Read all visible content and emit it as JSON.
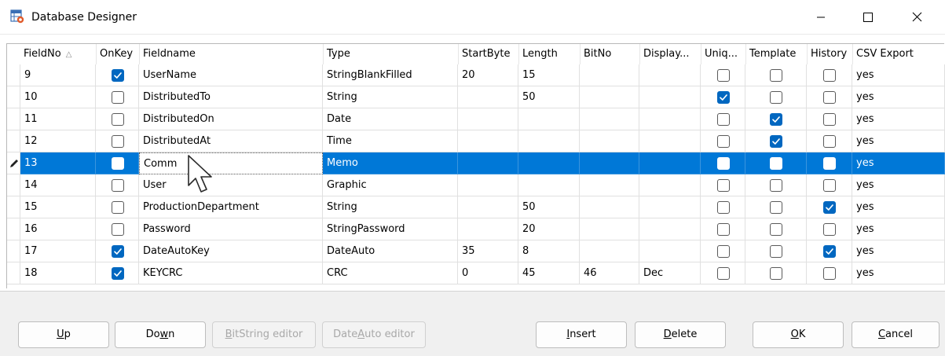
{
  "window": {
    "title": "Database Designer",
    "accent": "#0078d7",
    "icons": [
      "database-app-icon",
      "minimize-icon",
      "maximize-icon",
      "close-icon"
    ]
  },
  "grid": {
    "columns": [
      "FieldNo",
      "OnKey",
      "Fieldname",
      "Type",
      "StartByte",
      "Length",
      "BitNo",
      "Display...",
      "Uniq...",
      "Template",
      "History",
      "CSV Export"
    ],
    "sort_indicator": "△",
    "rows": [
      {
        "fieldno": "9",
        "onkey": true,
        "fieldname": "UserName",
        "type": "StringBlankFilled",
        "startbyte": "20",
        "length": "15",
        "bitno": "",
        "display": "",
        "unique": false,
        "template": false,
        "history": false,
        "csv": "yes"
      },
      {
        "fieldno": "10",
        "onkey": false,
        "fieldname": "DistributedTo",
        "type": "String",
        "startbyte": "",
        "length": "50",
        "bitno": "",
        "display": "",
        "unique": true,
        "template": false,
        "history": false,
        "csv": "yes"
      },
      {
        "fieldno": "11",
        "onkey": false,
        "fieldname": "DistributedOn",
        "type": "Date",
        "startbyte": "",
        "length": "",
        "bitno": "",
        "display": "",
        "unique": false,
        "template": true,
        "history": false,
        "csv": "yes"
      },
      {
        "fieldno": "12",
        "onkey": false,
        "fieldname": "DistributedAt",
        "type": "Time",
        "startbyte": "",
        "length": "",
        "bitno": "",
        "display": "",
        "unique": false,
        "template": true,
        "history": false,
        "csv": "yes"
      },
      {
        "fieldno": "13",
        "onkey": false,
        "fieldname": "Comm",
        "type": "Memo",
        "startbyte": "",
        "length": "",
        "bitno": "",
        "display": "",
        "unique": false,
        "template": false,
        "history": false,
        "csv": "yes",
        "selected": true
      },
      {
        "fieldno": "14",
        "onkey": false,
        "fieldname": "User",
        "type": "Graphic",
        "startbyte": "",
        "length": "",
        "bitno": "",
        "display": "",
        "unique": false,
        "template": false,
        "history": false,
        "csv": "yes"
      },
      {
        "fieldno": "15",
        "onkey": false,
        "fieldname": "ProductionDepartment",
        "type": "String",
        "startbyte": "",
        "length": "50",
        "bitno": "",
        "display": "",
        "unique": false,
        "template": false,
        "history": true,
        "csv": "yes"
      },
      {
        "fieldno": "16",
        "onkey": false,
        "fieldname": "Password",
        "type": "StringPassword",
        "startbyte": "",
        "length": "20",
        "bitno": "",
        "display": "",
        "unique": false,
        "template": false,
        "history": false,
        "csv": "yes"
      },
      {
        "fieldno": "17",
        "onkey": true,
        "fieldname": "DateAutoKey",
        "type": "DateAuto",
        "startbyte": "35",
        "length": "8",
        "bitno": "",
        "display": "",
        "unique": false,
        "template": false,
        "history": true,
        "csv": "yes"
      },
      {
        "fieldno": "18",
        "onkey": true,
        "fieldname": "KEYCRC",
        "type": "CRC",
        "startbyte": "0",
        "length": "45",
        "bitno": "46",
        "display": "Dec",
        "unique": false,
        "template": false,
        "history": false,
        "csv": "yes"
      }
    ]
  },
  "buttons": {
    "up": {
      "pre": "",
      "key": "U",
      "post": "p"
    },
    "down": {
      "pre": "Do",
      "key": "w",
      "post": "n"
    },
    "bitstring": {
      "pre": "",
      "key": "B",
      "post": "itString editor"
    },
    "dateauto": {
      "pre": "Date",
      "key": "A",
      "post": "uto editor"
    },
    "insert": {
      "pre": "",
      "key": "I",
      "post": "nsert"
    },
    "delete": {
      "pre": "",
      "key": "D",
      "post": "elete"
    },
    "ok": {
      "pre": "",
      "key": "O",
      "post": "K"
    },
    "cancel": {
      "pre": "",
      "key": "C",
      "post": "ancel"
    }
  }
}
